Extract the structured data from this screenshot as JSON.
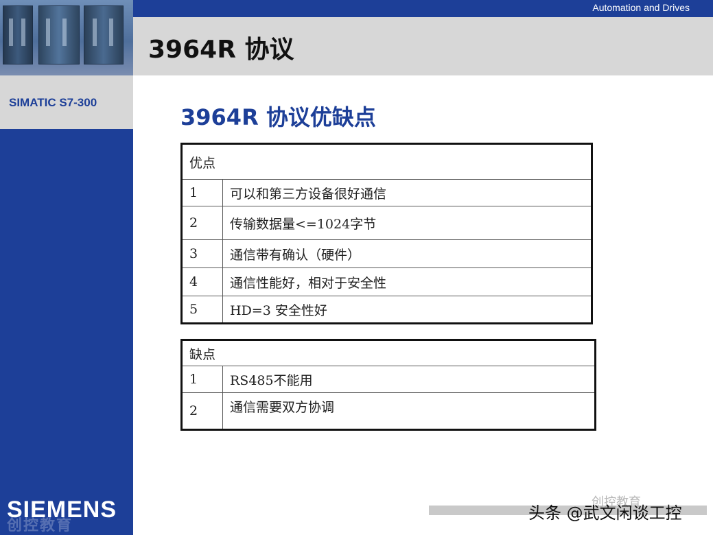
{
  "header": {
    "brand_text": "Automation and Drives",
    "title": "3964R 协议"
  },
  "sidebar": {
    "product_label": "SIMATIC S7-300",
    "logo": "SIEMENS",
    "logo_sub": "创控教育"
  },
  "main": {
    "heading": "3964R 协议优缺点",
    "advantages": {
      "header": "优点",
      "rows": [
        {
          "num": "1",
          "text": "可以和第三方设备很好通信"
        },
        {
          "num": "2",
          "text": "传输数据量<=1024字节"
        },
        {
          "num": "3",
          "text": "通信带有确认（硬件）"
        },
        {
          "num": "4",
          "text": "通信性能好，相对于安全性"
        },
        {
          "num": "5",
          "text": "HD=3 安全性好"
        }
      ]
    },
    "disadvantages": {
      "header": "缺点",
      "rows": [
        {
          "num": "1",
          "text": "RS485不能用"
        },
        {
          "num": "2",
          "text": "通信需要双方协调"
        }
      ]
    }
  },
  "footer": {
    "watermark": "头条 @武文闲谈工控",
    "watermark_faint": "创控教育"
  },
  "colors": {
    "siemens_blue": "#1d3f98",
    "panel_gray": "#d7d7d7"
  }
}
